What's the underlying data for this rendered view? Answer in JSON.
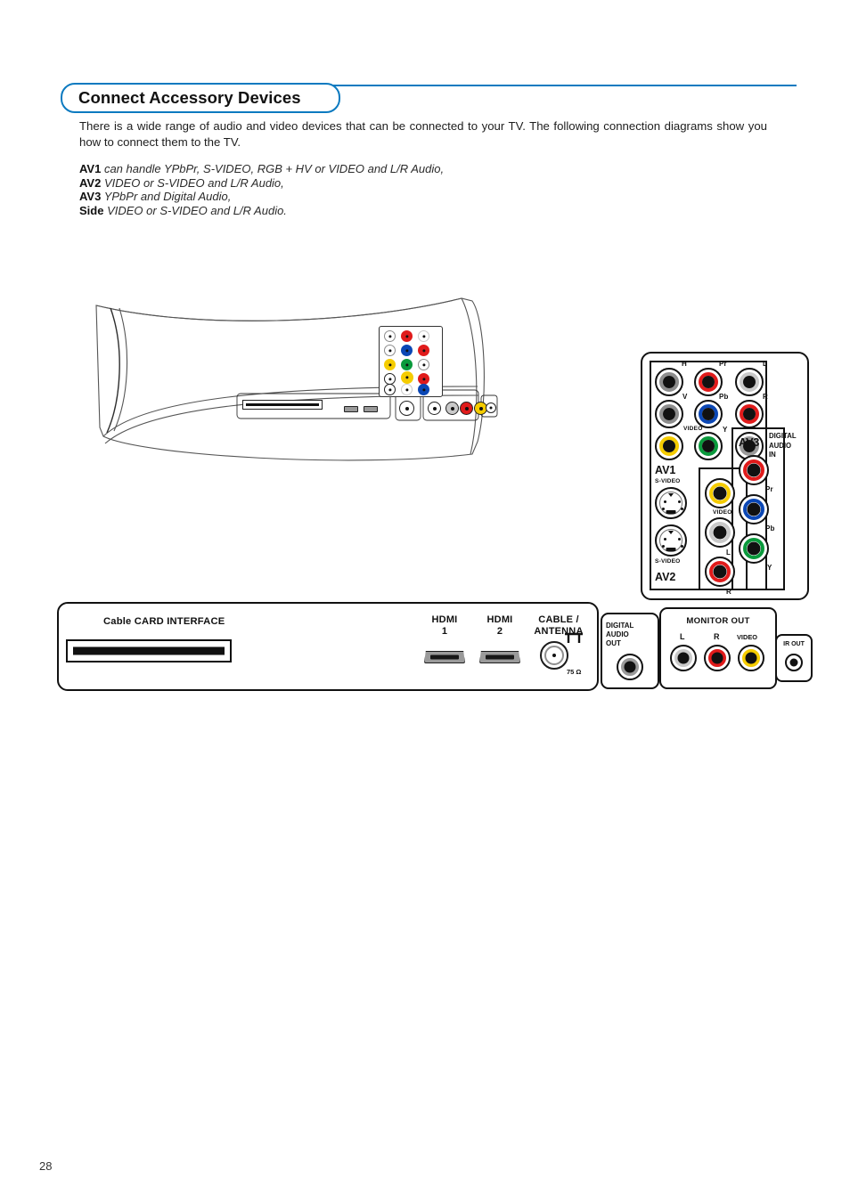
{
  "page": {
    "number": "28",
    "title": "Connect Accessory Devices",
    "accent_color": "#0b7ac0"
  },
  "intro": {
    "paragraph": "There is a wide range of audio and video devices that can be connected to your TV. The following connection diagrams show you how to connect them to the TV."
  },
  "av_capabilities": [
    {
      "name": "AV1",
      "text": "can handle YPbPr, S-VIDEO, RGB + HV or VIDEO and L/R Audio,"
    },
    {
      "name": "AV2",
      "text": "VIDEO or S-VIDEO and L/R Audio,"
    },
    {
      "name": "AV3",
      "text": "YPbPr and Digital Audio,"
    },
    {
      "name": "Side",
      "text": "VIDEO or S-VIDEO and L/R Audio."
    }
  ],
  "bottom_strip": {
    "cablecard_label": "Cable CARD INTERFACE",
    "hdmi1": {
      "line1": "HDMI",
      "line2": "1"
    },
    "hdmi2": {
      "line1": "HDMI",
      "line2": "2"
    },
    "cable_antenna": {
      "line1": "CABLE /",
      "line2": "ANTENNA",
      "impedance": "75 Ω"
    }
  },
  "digital_audio_out": {
    "line1": "DIGITAL",
    "line2": "AUDIO",
    "line3": "OUT"
  },
  "monitor_out": {
    "title": "MONITOR OUT",
    "jacks": [
      {
        "label": "L",
        "color": "#c9c9c9"
      },
      {
        "label": "R",
        "color": "#e01b1b"
      },
      {
        "label": "VIDEO",
        "color": "#f5cc00"
      }
    ]
  },
  "ir_out": {
    "label": "IR OUT"
  },
  "av_panel": {
    "groups": [
      {
        "name": "AV1"
      },
      {
        "name": "AV2"
      },
      {
        "name": "AV3"
      }
    ],
    "digital_audio_in": {
      "line1": "DIGITAL",
      "line2": "AUDIO",
      "line3": "IN"
    },
    "jacks": [
      {
        "label": "H",
        "color": "#8d8d8d",
        "group": "AV1"
      },
      {
        "label": "Pr",
        "color": "#e01b1b",
        "group": "AV1"
      },
      {
        "label": "L",
        "color": "#c9c9c9",
        "group": "AV1"
      },
      {
        "label": "V",
        "color": "#8d8d8d",
        "group": "AV1"
      },
      {
        "label": "Pb",
        "color": "#0b47b5",
        "group": "AV1"
      },
      {
        "label": "R",
        "color": "#e01b1b",
        "group": "AV1"
      },
      {
        "label": "VIDEO",
        "color": "#f5cc00",
        "group": "AV1"
      },
      {
        "label": "Y",
        "color": "#0a9a3c",
        "group": "AV1"
      },
      {
        "label": "DIGITAL AUDIO IN",
        "color": "#8d8d8d",
        "group": "AV3"
      },
      {
        "label": "VIDEO",
        "color": "#f5cc00",
        "group": "AV2"
      },
      {
        "label": "L",
        "color": "#c9c9c9",
        "group": "AV2"
      },
      {
        "label": "R",
        "color": "#e01b1b",
        "group": "AV2"
      },
      {
        "label": "Pr",
        "color": "#e01b1b",
        "group": "AV3"
      },
      {
        "label": "Pb",
        "color": "#0b47b5",
        "group": "AV3"
      },
      {
        "label": "Y",
        "color": "#0a9a3c",
        "group": "AV3"
      }
    ],
    "svideo_label": "S-VIDEO"
  }
}
